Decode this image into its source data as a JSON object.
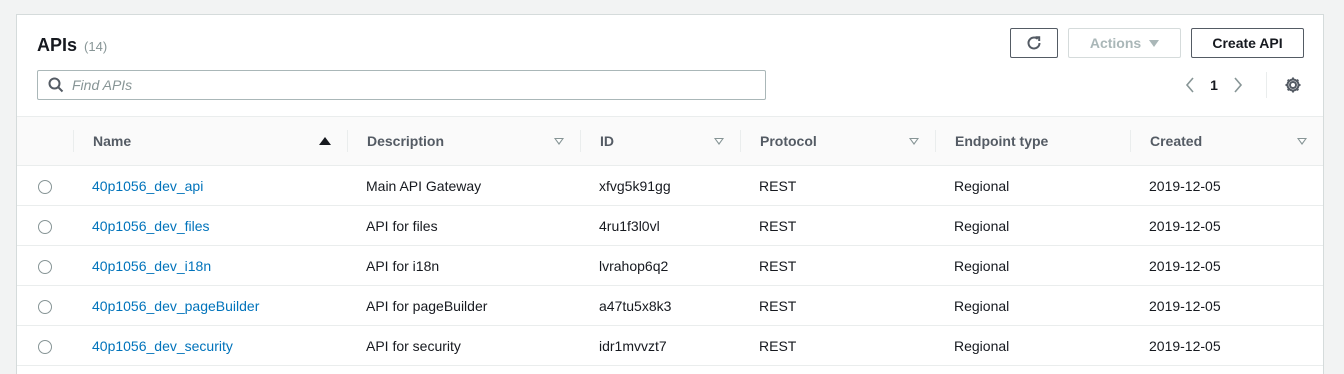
{
  "header": {
    "title": "APIs",
    "count": "(14)",
    "actions_label": "Actions",
    "create_label": "Create API"
  },
  "search": {
    "placeholder": "Find APIs"
  },
  "pagination": {
    "current_page": "1"
  },
  "table": {
    "columns": [
      {
        "label": "Name",
        "sort": "ascending"
      },
      {
        "label": "Description",
        "sort": "none"
      },
      {
        "label": "ID",
        "sort": "none"
      },
      {
        "label": "Protocol",
        "sort": "none"
      },
      {
        "label": "Endpoint type",
        "sort": "none"
      },
      {
        "label": "Created",
        "sort": "none"
      }
    ],
    "rows": [
      {
        "name": "40p1056_dev_api",
        "description": "Main API Gateway",
        "id": "xfvg5k91gg",
        "protocol": "REST",
        "endpoint_type": "Regional",
        "created": "2019-12-05"
      },
      {
        "name": "40p1056_dev_files",
        "description": "API for files",
        "id": "4ru1f3l0vl",
        "protocol": "REST",
        "endpoint_type": "Regional",
        "created": "2019-12-05"
      },
      {
        "name": "40p1056_dev_i18n",
        "description": "API for i18n",
        "id": "lvrahop6q2",
        "protocol": "REST",
        "endpoint_type": "Regional",
        "created": "2019-12-05"
      },
      {
        "name": "40p1056_dev_pageBuilder",
        "description": "API for pageBuilder",
        "id": "a47tu5x8k3",
        "protocol": "REST",
        "endpoint_type": "Regional",
        "created": "2019-12-05"
      },
      {
        "name": "40p1056_dev_security",
        "description": "API for security",
        "id": "idr1mvvzt7",
        "protocol": "REST",
        "endpoint_type": "Regional",
        "created": "2019-12-05"
      }
    ]
  },
  "icons": {
    "refresh": "refresh-icon",
    "search": "search-icon",
    "prev": "chevron-left-icon",
    "next": "chevron-right-icon",
    "settings": "gear-icon"
  },
  "colors": {
    "link": "#0073bb",
    "border": "#d5dbdb",
    "muted": "#879596"
  }
}
